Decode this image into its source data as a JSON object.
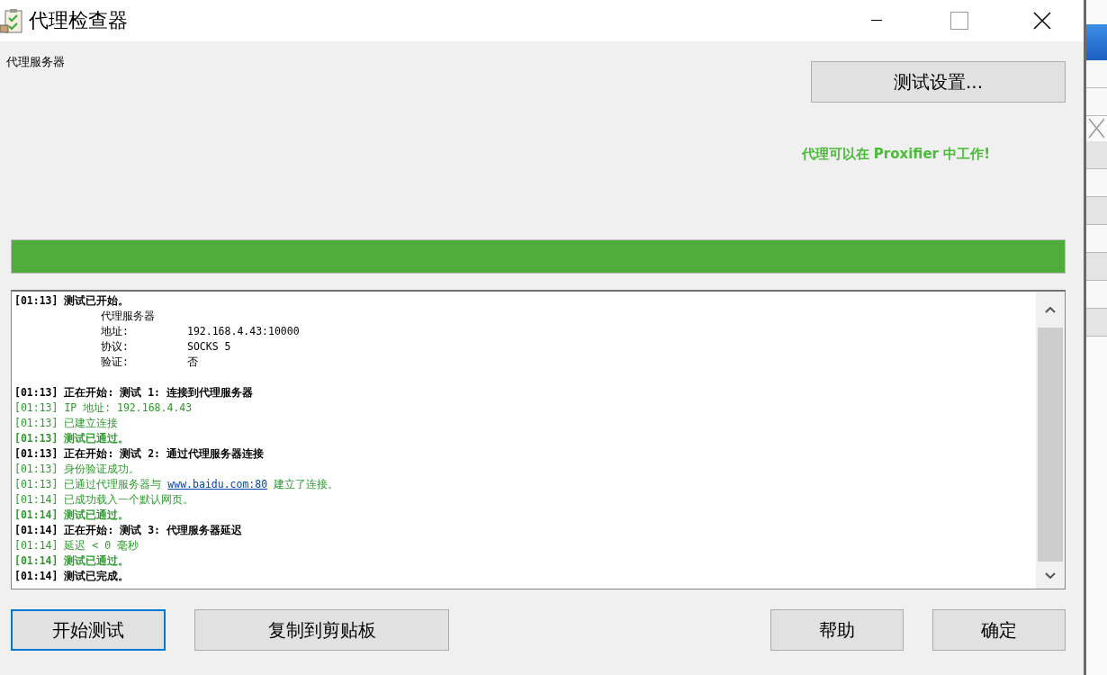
{
  "window": {
    "title": "代理检查器"
  },
  "proxy_label": "代理服务器",
  "settings_button": "测试设置...",
  "status_message": "代理可以在 Proxifier 中工作!",
  "progress": {
    "level": 1
  },
  "log": [
    {
      "kind": "header",
      "time": "[01:13]",
      "text": "测试已开始。"
    },
    {
      "kind": "detail",
      "label": "代理服务器"
    },
    {
      "kind": "detail",
      "label": "地址:",
      "value": "192.168.4.43:10000"
    },
    {
      "kind": "detail",
      "label": "协议:",
      "value": "SOCKS 5"
    },
    {
      "kind": "detail",
      "label": "验证:",
      "value": "否"
    },
    {
      "kind": "spacer"
    },
    {
      "kind": "header",
      "time": "[01:13]",
      "text": "正在开始: 测试 1: 连接到代理服务器"
    },
    {
      "kind": "info",
      "time": "[01:13]",
      "text": "IP 地址: 192.168.4.43"
    },
    {
      "kind": "info",
      "time": "[01:13]",
      "text": "已建立连接"
    },
    {
      "kind": "pass",
      "time": "[01:13]",
      "text": "测试已通过。"
    },
    {
      "kind": "header",
      "time": "[01:13]",
      "text": "正在开始: 测试 2: 通过代理服务器连接"
    },
    {
      "kind": "info",
      "time": "[01:13]",
      "text": "身份验证成功。"
    },
    {
      "kind": "info",
      "time": "[01:13]",
      "text": "已通过代理服务器与",
      "link": "www.baidu.com:80",
      "text_after": "建立了连接。"
    },
    {
      "kind": "info",
      "time": "[01:14]",
      "text": "已成功载入一个默认网页。"
    },
    {
      "kind": "pass",
      "time": "[01:14]",
      "text": "测试已通过。"
    },
    {
      "kind": "header",
      "time": "[01:14]",
      "text": "正在开始: 测试 3: 代理服务器延迟"
    },
    {
      "kind": "info",
      "time": "[01:14]",
      "text": "延迟 < 0 毫秒"
    },
    {
      "kind": "pass",
      "time": "[01:14]",
      "text": "测试已通过。"
    },
    {
      "kind": "header",
      "time": "[01:14]",
      "text": "测试已完成。"
    }
  ],
  "buttons_left": [
    {
      "label": "开始测试",
      "focused": true
    },
    {
      "label": "复制到剪贴板",
      "focused": false
    }
  ],
  "buttons_right": [
    {
      "label": "帮助",
      "focused": false
    },
    {
      "label": "确定",
      "focused": false
    }
  ]
}
